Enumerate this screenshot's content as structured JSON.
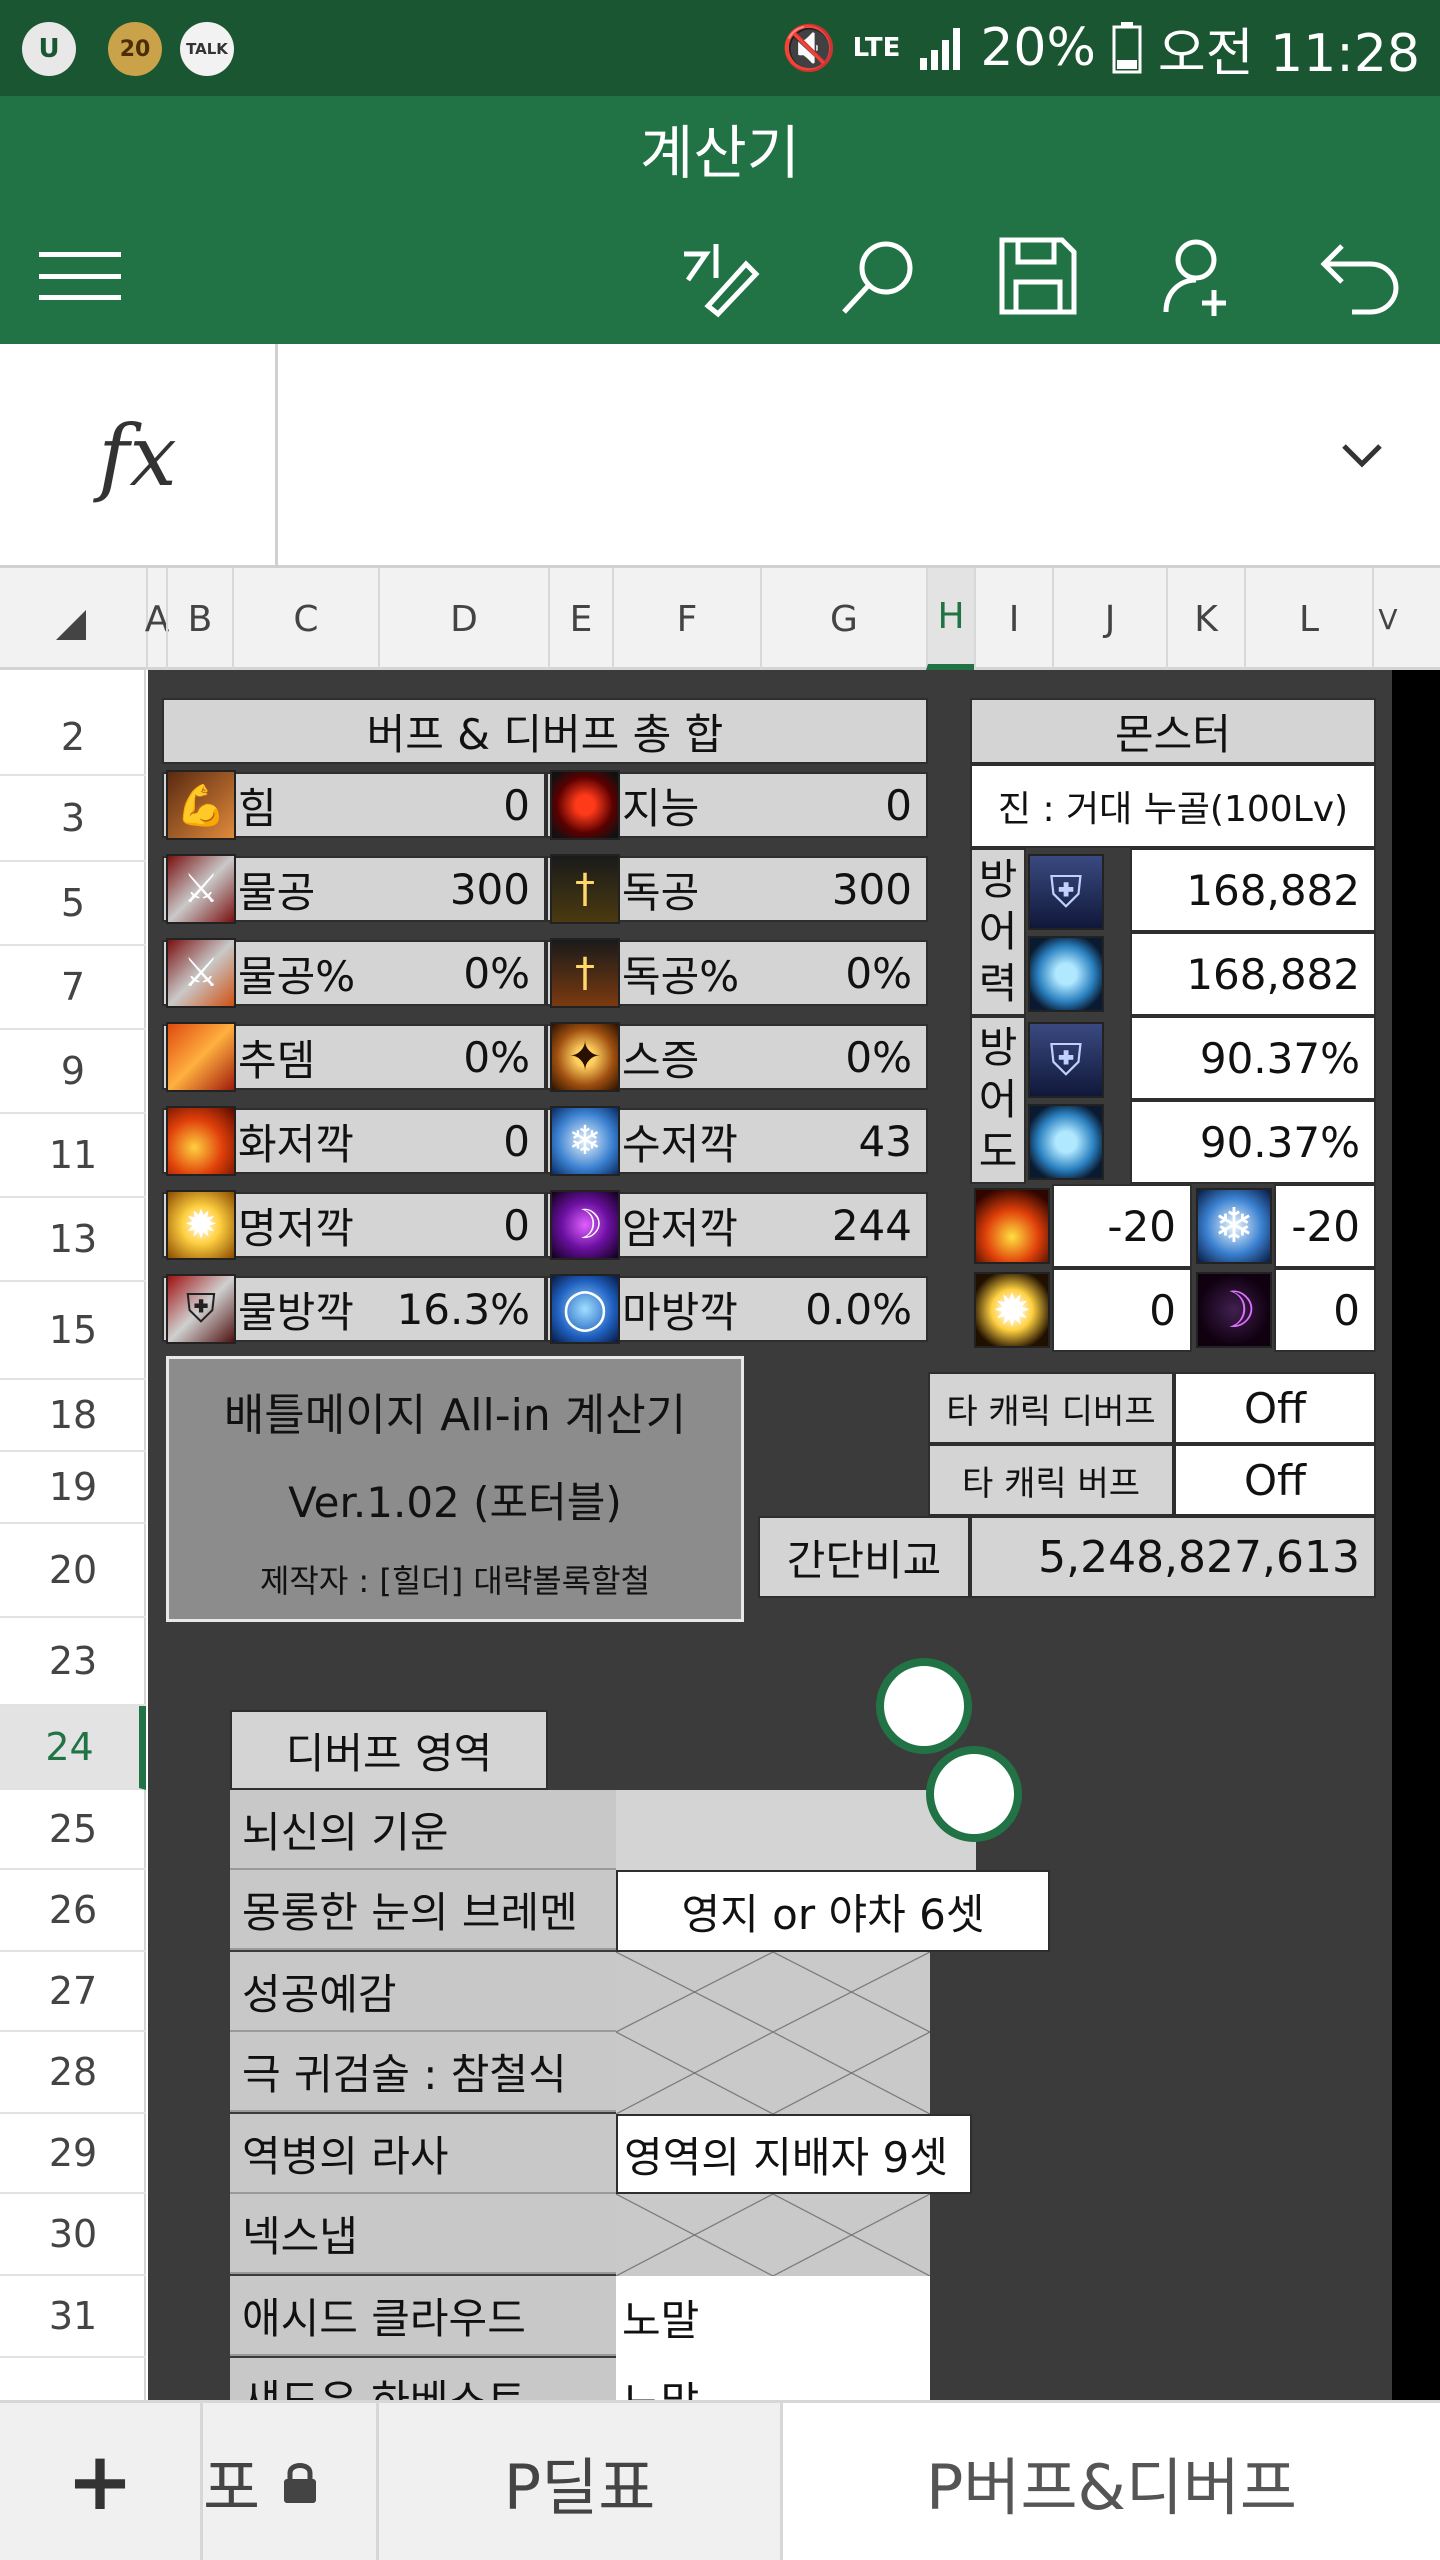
{
  "status_bar": {
    "notif_badge": "20",
    "talk_label": "TALK",
    "network": "LTE",
    "battery": "20%",
    "time": "오전 11:28"
  },
  "app_bar": {
    "title": "계산기",
    "tools": [
      "menu-icon",
      "pen-icon",
      "search-icon",
      "save-icon",
      "share-person-icon",
      "undo-icon"
    ]
  },
  "formula_bar": {
    "fx_label": "fx",
    "content": "",
    "expand_icon": "chevron-down-icon"
  },
  "columns": [
    "A",
    "B",
    "C",
    "D",
    "E",
    "F",
    "G",
    "H",
    "I",
    "J",
    "K",
    "L",
    "V"
  ],
  "selected_column": "H",
  "rows": [
    "2",
    "3",
    "5",
    "7",
    "9",
    "11",
    "13",
    "15",
    "18",
    "19",
    "20",
    "23",
    "24",
    "25",
    "26",
    "27",
    "28",
    "29",
    "30",
    "31"
  ],
  "selected_row": "24",
  "buff_panel": {
    "header": "버프 & 디버프 총 합",
    "stats": [
      {
        "left_label": "힘",
        "left_value": "0",
        "right_label": "지능",
        "right_value": "0"
      },
      {
        "left_label": "물공",
        "left_value": "300",
        "right_label": "독공",
        "right_value": "300"
      },
      {
        "left_label": "물공%",
        "left_value": "0%",
        "right_label": "독공%",
        "right_value": "0%"
      },
      {
        "left_label": "추뎀",
        "left_value": "0%",
        "right_label": "스증",
        "right_value": "0%"
      },
      {
        "left_label": "화저깍",
        "left_value": "0",
        "right_label": "수저깍",
        "right_value": "43"
      },
      {
        "left_label": "명저깍",
        "left_value": "0",
        "right_label": "암저깍",
        "right_value": "244"
      },
      {
        "left_label": "물방깍",
        "left_value": "16.3%",
        "right_label": "마방깍",
        "right_value": "0.0%"
      }
    ]
  },
  "monster_panel": {
    "header": "몬스터",
    "name": "진 : 거대 누골(100Lv)",
    "defense_label": "방어력",
    "defense_phys": "168,882",
    "defense_mag": "168,882",
    "defense_rate_label": "방어도",
    "rate_phys": "90.37%",
    "rate_mag": "90.37%",
    "res_fire": "-20",
    "res_water": "-20",
    "res_light": "0",
    "res_dark": "0"
  },
  "info_box": {
    "title": "배틀메이지 All-in 계산기",
    "version": "Ver.1.02 (포터블)",
    "author": "제작자 : [힐더] 대략볼록할철"
  },
  "toggles": [
    {
      "label": "타 캐릭 디버프",
      "value": "Off"
    },
    {
      "label": "타 캐릭 버프",
      "value": "Off"
    }
  ],
  "compare": {
    "label": "간단비교",
    "value": "5,248,827,613"
  },
  "debuff_area": {
    "header": "디버프 영역",
    "items": [
      {
        "label": "뇌신의 기운",
        "value": ""
      },
      {
        "label": "몽롱한 눈의 브레멘",
        "value": "영지 or 야차 6셋"
      },
      {
        "label": "성공예감",
        "value": ""
      },
      {
        "label": "극 귀검술 : 참철식",
        "value": ""
      },
      {
        "label": "역병의 라사",
        "value": "영역의 지배자 9셋"
      },
      {
        "label": "넥스냅",
        "value": ""
      },
      {
        "label": "애시드 클라우드",
        "value": "노말"
      },
      {
        "label": "섀도우 하베스트",
        "value": "노말"
      }
    ]
  },
  "sheet_tabs": [
    {
      "label": "+"
    },
    {
      "label": "포"
    },
    {
      "label": "P딜표"
    },
    {
      "label": "P버프&디버프",
      "active": true
    }
  ],
  "colors": {
    "excel_green": "#217346",
    "status_green": "#1a5631",
    "sheet_bg": "#3b3b3b",
    "cell_gray": "#d4d4d4"
  }
}
